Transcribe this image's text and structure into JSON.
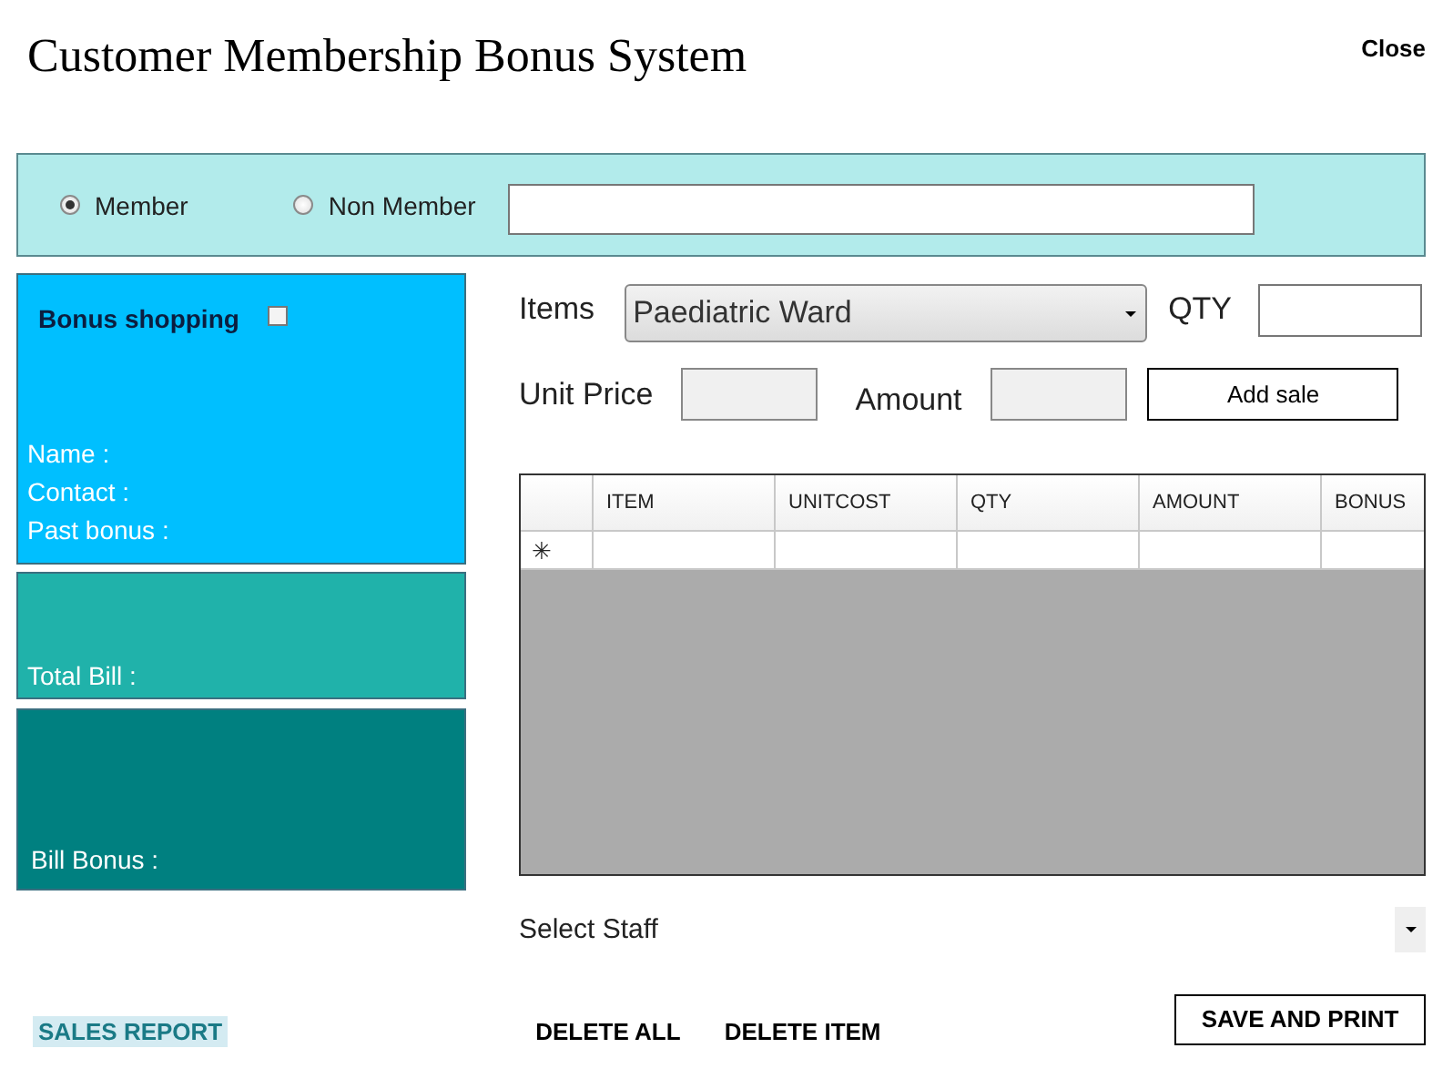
{
  "window": {
    "title": "Customer Membership Bonus System",
    "close": "Close"
  },
  "member_type": [
    {
      "label": "Member",
      "selected": true
    },
    {
      "label": "Non Member",
      "selected": false
    }
  ],
  "customer_panel": {
    "bonus_shopping": {
      "label": "Bonus shopping",
      "checked": false
    },
    "fields": [
      "Name :",
      "Contact :",
      "Past bonus :"
    ]
  },
  "total_bill": {
    "label": "Total Bill :"
  },
  "bill_bonus": {
    "label": "Bill Bonus :"
  },
  "items": {
    "label": "Items",
    "value": "Paediatric Ward"
  },
  "qty": {
    "label": "QTY"
  },
  "unit_price": {
    "label": "Unit Price"
  },
  "amount": {
    "label": "Amount"
  },
  "add_sale": "Add sale",
  "table": {
    "columns": [
      "ITEM",
      "UNITCOST",
      "QTY",
      "AMOUNT",
      "BONUS"
    ],
    "new_row_marker": "✳"
  },
  "staff": {
    "prompt": "Select Staff"
  },
  "actions": {
    "sales_report": "SALES REPORT",
    "delete_all": "DELETE ALL",
    "delete_item": "DELETE ITEM",
    "save_and_print": "SAVE AND PRINT"
  }
}
